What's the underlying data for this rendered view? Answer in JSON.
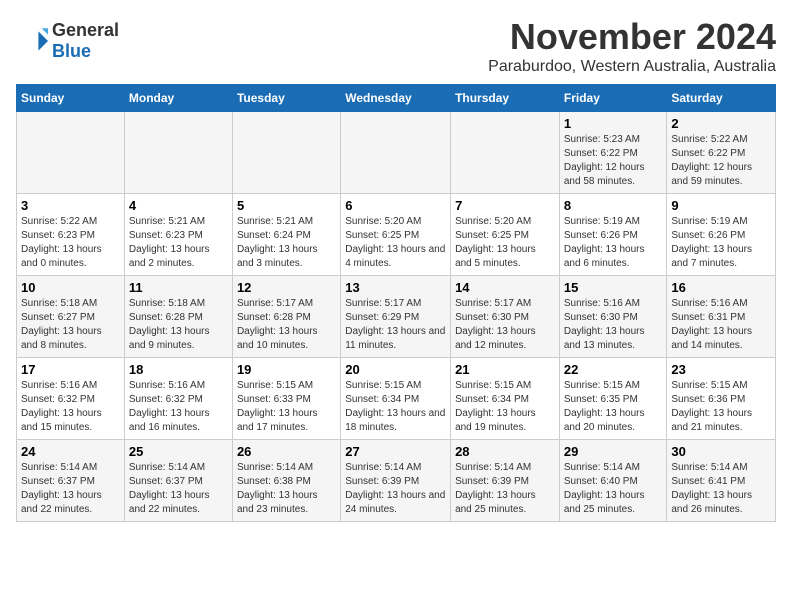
{
  "header": {
    "logo_line1": "General",
    "logo_line2": "Blue",
    "month": "November 2024",
    "location": "Paraburdoo, Western Australia, Australia"
  },
  "weekdays": [
    "Sunday",
    "Monday",
    "Tuesday",
    "Wednesday",
    "Thursday",
    "Friday",
    "Saturday"
  ],
  "weeks": [
    [
      {
        "day": "",
        "sunrise": "",
        "sunset": "",
        "daylight": ""
      },
      {
        "day": "",
        "sunrise": "",
        "sunset": "",
        "daylight": ""
      },
      {
        "day": "",
        "sunrise": "",
        "sunset": "",
        "daylight": ""
      },
      {
        "day": "",
        "sunrise": "",
        "sunset": "",
        "daylight": ""
      },
      {
        "day": "",
        "sunrise": "",
        "sunset": "",
        "daylight": ""
      },
      {
        "day": "1",
        "sunrise": "Sunrise: 5:23 AM",
        "sunset": "Sunset: 6:22 PM",
        "daylight": "Daylight: 12 hours and 58 minutes."
      },
      {
        "day": "2",
        "sunrise": "Sunrise: 5:22 AM",
        "sunset": "Sunset: 6:22 PM",
        "daylight": "Daylight: 12 hours and 59 minutes."
      }
    ],
    [
      {
        "day": "3",
        "sunrise": "Sunrise: 5:22 AM",
        "sunset": "Sunset: 6:23 PM",
        "daylight": "Daylight: 13 hours and 0 minutes."
      },
      {
        "day": "4",
        "sunrise": "Sunrise: 5:21 AM",
        "sunset": "Sunset: 6:23 PM",
        "daylight": "Daylight: 13 hours and 2 minutes."
      },
      {
        "day": "5",
        "sunrise": "Sunrise: 5:21 AM",
        "sunset": "Sunset: 6:24 PM",
        "daylight": "Daylight: 13 hours and 3 minutes."
      },
      {
        "day": "6",
        "sunrise": "Sunrise: 5:20 AM",
        "sunset": "Sunset: 6:25 PM",
        "daylight": "Daylight: 13 hours and 4 minutes."
      },
      {
        "day": "7",
        "sunrise": "Sunrise: 5:20 AM",
        "sunset": "Sunset: 6:25 PM",
        "daylight": "Daylight: 13 hours and 5 minutes."
      },
      {
        "day": "8",
        "sunrise": "Sunrise: 5:19 AM",
        "sunset": "Sunset: 6:26 PM",
        "daylight": "Daylight: 13 hours and 6 minutes."
      },
      {
        "day": "9",
        "sunrise": "Sunrise: 5:19 AM",
        "sunset": "Sunset: 6:26 PM",
        "daylight": "Daylight: 13 hours and 7 minutes."
      }
    ],
    [
      {
        "day": "10",
        "sunrise": "Sunrise: 5:18 AM",
        "sunset": "Sunset: 6:27 PM",
        "daylight": "Daylight: 13 hours and 8 minutes."
      },
      {
        "day": "11",
        "sunrise": "Sunrise: 5:18 AM",
        "sunset": "Sunset: 6:28 PM",
        "daylight": "Daylight: 13 hours and 9 minutes."
      },
      {
        "day": "12",
        "sunrise": "Sunrise: 5:17 AM",
        "sunset": "Sunset: 6:28 PM",
        "daylight": "Daylight: 13 hours and 10 minutes."
      },
      {
        "day": "13",
        "sunrise": "Sunrise: 5:17 AM",
        "sunset": "Sunset: 6:29 PM",
        "daylight": "Daylight: 13 hours and 11 minutes."
      },
      {
        "day": "14",
        "sunrise": "Sunrise: 5:17 AM",
        "sunset": "Sunset: 6:30 PM",
        "daylight": "Daylight: 13 hours and 12 minutes."
      },
      {
        "day": "15",
        "sunrise": "Sunrise: 5:16 AM",
        "sunset": "Sunset: 6:30 PM",
        "daylight": "Daylight: 13 hours and 13 minutes."
      },
      {
        "day": "16",
        "sunrise": "Sunrise: 5:16 AM",
        "sunset": "Sunset: 6:31 PM",
        "daylight": "Daylight: 13 hours and 14 minutes."
      }
    ],
    [
      {
        "day": "17",
        "sunrise": "Sunrise: 5:16 AM",
        "sunset": "Sunset: 6:32 PM",
        "daylight": "Daylight: 13 hours and 15 minutes."
      },
      {
        "day": "18",
        "sunrise": "Sunrise: 5:16 AM",
        "sunset": "Sunset: 6:32 PM",
        "daylight": "Daylight: 13 hours and 16 minutes."
      },
      {
        "day": "19",
        "sunrise": "Sunrise: 5:15 AM",
        "sunset": "Sunset: 6:33 PM",
        "daylight": "Daylight: 13 hours and 17 minutes."
      },
      {
        "day": "20",
        "sunrise": "Sunrise: 5:15 AM",
        "sunset": "Sunset: 6:34 PM",
        "daylight": "Daylight: 13 hours and 18 minutes."
      },
      {
        "day": "21",
        "sunrise": "Sunrise: 5:15 AM",
        "sunset": "Sunset: 6:34 PM",
        "daylight": "Daylight: 13 hours and 19 minutes."
      },
      {
        "day": "22",
        "sunrise": "Sunrise: 5:15 AM",
        "sunset": "Sunset: 6:35 PM",
        "daylight": "Daylight: 13 hours and 20 minutes."
      },
      {
        "day": "23",
        "sunrise": "Sunrise: 5:15 AM",
        "sunset": "Sunset: 6:36 PM",
        "daylight": "Daylight: 13 hours and 21 minutes."
      }
    ],
    [
      {
        "day": "24",
        "sunrise": "Sunrise: 5:14 AM",
        "sunset": "Sunset: 6:37 PM",
        "daylight": "Daylight: 13 hours and 22 minutes."
      },
      {
        "day": "25",
        "sunrise": "Sunrise: 5:14 AM",
        "sunset": "Sunset: 6:37 PM",
        "daylight": "Daylight: 13 hours and 22 minutes."
      },
      {
        "day": "26",
        "sunrise": "Sunrise: 5:14 AM",
        "sunset": "Sunset: 6:38 PM",
        "daylight": "Daylight: 13 hours and 23 minutes."
      },
      {
        "day": "27",
        "sunrise": "Sunrise: 5:14 AM",
        "sunset": "Sunset: 6:39 PM",
        "daylight": "Daylight: 13 hours and 24 minutes."
      },
      {
        "day": "28",
        "sunrise": "Sunrise: 5:14 AM",
        "sunset": "Sunset: 6:39 PM",
        "daylight": "Daylight: 13 hours and 25 minutes."
      },
      {
        "day": "29",
        "sunrise": "Sunrise: 5:14 AM",
        "sunset": "Sunset: 6:40 PM",
        "daylight": "Daylight: 13 hours and 25 minutes."
      },
      {
        "day": "30",
        "sunrise": "Sunrise: 5:14 AM",
        "sunset": "Sunset: 6:41 PM",
        "daylight": "Daylight: 13 hours and 26 minutes."
      }
    ]
  ]
}
